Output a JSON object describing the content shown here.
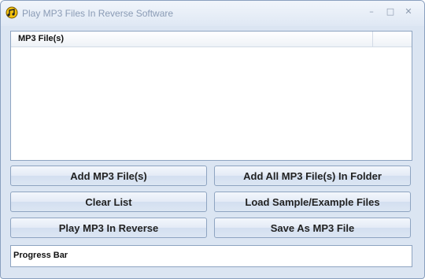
{
  "window": {
    "title": "Play MP3 Files In Reverse Software",
    "minimize": "–",
    "maximize": "□",
    "close": "✕"
  },
  "file_list": {
    "columns": [
      "MP3 File(s)"
    ],
    "rows": []
  },
  "buttons": {
    "add_files": "Add MP3 File(s)",
    "add_folder": "Add All MP3 File(s) In Folder",
    "clear_list": "Clear List",
    "load_sample": "Load Sample/Example Files",
    "play_reverse": "Play MP3 In Reverse",
    "save_as": "Save As MP3 File"
  },
  "progress": {
    "label": "Progress Bar"
  },
  "colors": {
    "window_bg": "#dbe5f2",
    "border": "#8ea4c1",
    "icon_yellow": "#f4c20d"
  }
}
